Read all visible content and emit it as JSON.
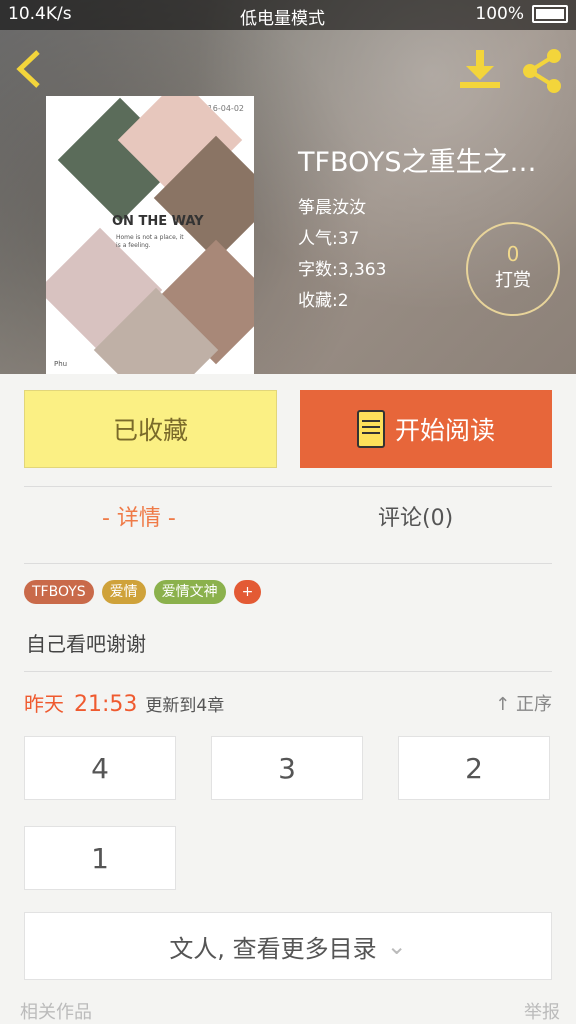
{
  "status": {
    "net": "10.4K/s",
    "mode": "低电量模式",
    "battery": "100%"
  },
  "book": {
    "title": "TFBOYS之重生之…",
    "author": "筝晨汝汝",
    "popularity": "人气:37",
    "words": "字数:3,363",
    "favorites": "收藏:2"
  },
  "reward": {
    "count": "0",
    "label": "打赏"
  },
  "cover": {
    "date": "2016-04-02",
    "title": "ON THE WAY",
    "subtitle": "Home is not a place, it is a feeling.",
    "credit": "Phu"
  },
  "actions": {
    "collect": "已收藏",
    "read": "开始阅读"
  },
  "tabs": {
    "detail": "- 详情 -",
    "comment": "评论(0)"
  },
  "tags": [
    {
      "label": "TFBOYS",
      "color": "#c96a4a"
    },
    {
      "label": "爱情",
      "color": "#cfa23a"
    },
    {
      "label": "爱情文神",
      "color": "#8bb14c"
    },
    {
      "label": "+",
      "color": "#e35a34"
    }
  ],
  "description": "自己看吧谢谢",
  "update": {
    "day": "昨天",
    "time": "21:53",
    "text": "更新到4章"
  },
  "order_label": "正序",
  "chapters": [
    "4",
    "3",
    "2",
    "1"
  ],
  "more_label": "文人, 查看更多目录",
  "bottom": {
    "left": "相关作品",
    "right": "举报"
  }
}
